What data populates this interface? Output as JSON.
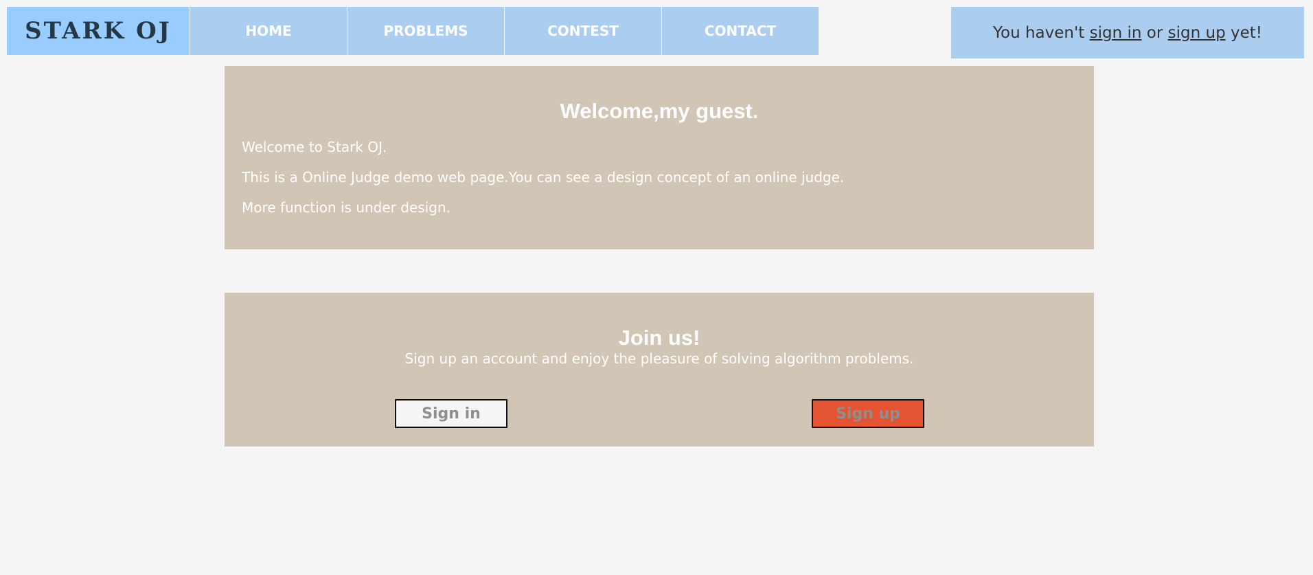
{
  "brand": {
    "logo_text": "STARK OJ"
  },
  "nav": {
    "items": [
      {
        "label": "HOME"
      },
      {
        "label": "PROBLEMS"
      },
      {
        "label": "CONTEST"
      },
      {
        "label": "CONTACT"
      }
    ]
  },
  "auth": {
    "prefix": "You haven't ",
    "signin_link": "sign in",
    "middle": " or ",
    "signup_link": "sign up",
    "suffix": " yet!"
  },
  "welcome": {
    "title": "Welcome,my guest.",
    "lines": [
      "Welcome to Stark OJ.",
      "This is a Online Judge demo web page.You can see a design concept of an online judge.",
      "More function is under design."
    ]
  },
  "join": {
    "title": "Join us!",
    "description": "Sign up an account and enjoy the pleasure of solving algorithm problems.",
    "signin_button": "Sign in",
    "signup_button": "Sign up"
  },
  "colors": {
    "background": "#f5f5f5",
    "logo_bg": "#99ccff",
    "nav_bg": "#abcdf0",
    "panel_bg": "#d1c5b6",
    "signup_button_bg": "#e55432"
  }
}
